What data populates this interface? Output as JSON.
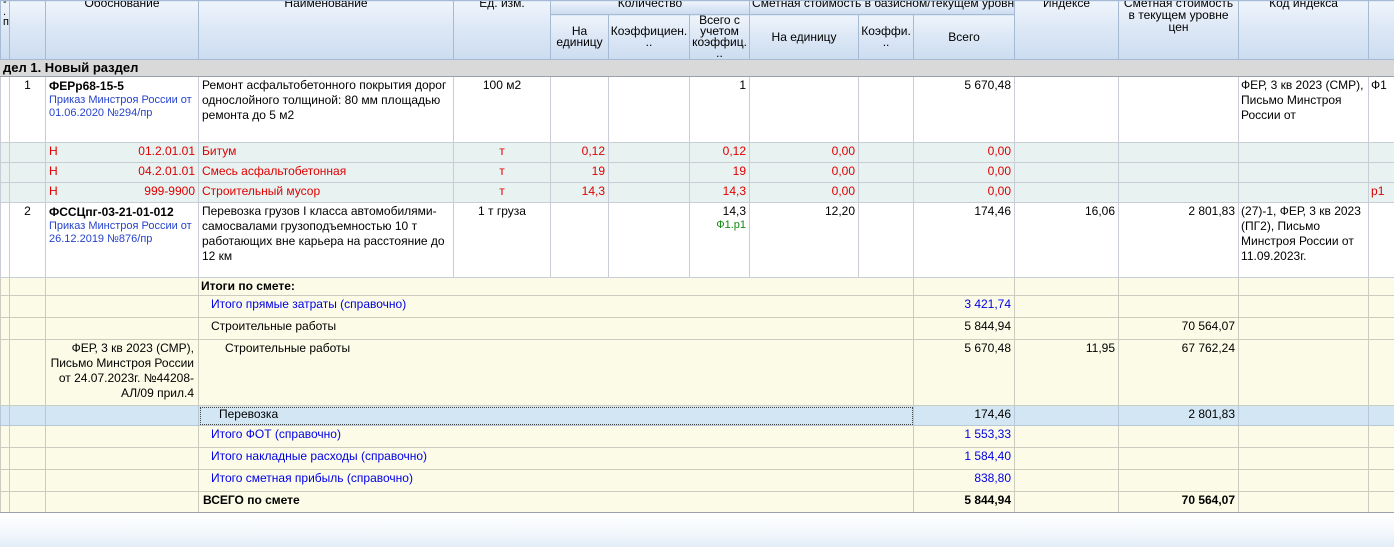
{
  "header": {
    "npp_line1": "-",
    "npp_line2": ".п",
    "justification": "Обоснование",
    "name": "Наименование",
    "unit": "Ед. изм.",
    "quantity_group": "Количество",
    "qty_per_unit": "На единицу",
    "qty_coeff": "Коэффициен...",
    "qty_total": "Всего с учетом коэффиц...",
    "cost_group": "Сметная стоимость в базисном/текущем уровне цен",
    "cost_per_unit": "На единицу",
    "cost_coeff": "Коэффи...",
    "cost_total": "Всего",
    "index": "Индексе",
    "cost_current": "Сметная стоимость в текущем уровне цен",
    "index_code": "Код индекса"
  },
  "section_title": "дел 1. Новый раздел",
  "items": [
    {
      "num": "1",
      "code": "ФЕРр68-15-5",
      "order": "Приказ Минстроя России от 01.06.2020 №294/пр",
      "name": "Ремонт асфальтобетонного покрытия дорог однослойного толщиной: 80 мм площадью ремонта до 5 м2",
      "unit": "100 м2",
      "qty_total": "1",
      "cost_total": "5 670,48",
      "index_code": "ФЕР, 3 кв 2023 (СМР), Письмо Минстроя России от",
      "flag": "Ф1"
    },
    {
      "marker": "Н",
      "code": "01.2.01.01",
      "name": "Битум",
      "unit": "т",
      "qty_unit": "0,12",
      "qty_total": "0,12",
      "cost_unit": "0,00",
      "cost_total": "0,00",
      "flag": ""
    },
    {
      "marker": "Н",
      "code": "04.2.01.01",
      "name": "Смесь асфальтобетонная",
      "unit": "т",
      "qty_unit": "19",
      "qty_total": "19",
      "cost_unit": "0,00",
      "cost_total": "0,00",
      "flag": ""
    },
    {
      "marker": "Н",
      "code": "999-9900",
      "name": "Строительный мусор",
      "unit": "т",
      "qty_unit": "14,3",
      "qty_total": "14,3",
      "cost_unit": "0,00",
      "cost_total": "0,00",
      "flag": "р1"
    },
    {
      "num": "2",
      "code": "ФССЦпг-03-21-01-012",
      "order": "Приказ Минстроя России от 26.12.2019 №876/пр",
      "name": "Перевозка грузов I класса автомобилями-самосвалами грузоподъемностью 10 т работающих вне карьера на расстояние до 12 км",
      "unit": "1 т груза",
      "qty_total": "14,3",
      "qty_formula": "Ф1.р1",
      "cost_unit": "12,20",
      "cost_total": "174,46",
      "index": "16,06",
      "cost_current": "2 801,83",
      "index_code": "(27)-1, ФЕР, 3 кв 2023 (ПГ2), Письмо Минстроя России от 11.09.2023г."
    }
  ],
  "totals": [
    {
      "label": "Итоги по смете:"
    },
    {
      "label": "Итого прямые затраты (справочно)",
      "total": "3 421,74"
    },
    {
      "label": "Строительные работы",
      "total": "5 844,94",
      "current": "70 564,07"
    },
    {
      "justification": "ФЕР, 3 кв 2023 (СМР), Письмо Минстроя России от 24.07.2023г. №44208-АЛ/09 прил.4",
      "label": "Строительные работы",
      "total": "5 670,48",
      "index": "11,95",
      "current": "67 762,24"
    },
    {
      "label": "Перевозка",
      "total": "174,46",
      "current": "2 801,83"
    },
    {
      "label": "Итого ФОТ (справочно)",
      "total": "1 553,33"
    },
    {
      "label": "Итого накладные расходы (справочно)",
      "total": "1 584,40"
    },
    {
      "label": "Итого сметная прибыль (справочно)",
      "total": "838,80"
    },
    {
      "label": "ВСЕГО по смете",
      "total": "5 844,94",
      "current": "70 564,07"
    }
  ],
  "colors": {
    "resource_text": "#e00000",
    "totals_blue": "#0000e6",
    "link_blue": "#2643cc",
    "formula_green": "#0f8a0f",
    "selection_bg": "#d3e6f4",
    "resource_bg": "#e7f2f1",
    "totals_bg": "#fbfbe7",
    "section_bg": "#d9d9d9",
    "header_bg": "#dde8f6"
  }
}
